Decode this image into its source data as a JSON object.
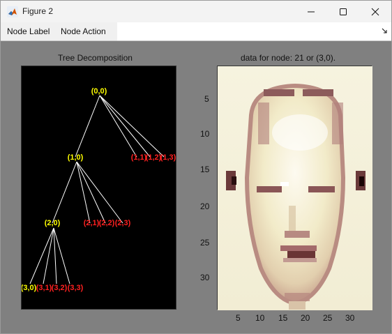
{
  "window": {
    "title": "Figure 2",
    "minimize_icon": "minimize-icon",
    "maximize_icon": "maximize-icon",
    "close_icon": "close-icon"
  },
  "menu": {
    "items": [
      "Node Label",
      "Node Action"
    ]
  },
  "colors": {
    "label_yellow": "#ffff00",
    "label_red": "#ff2020",
    "tree_lines": "#ffffff"
  },
  "tree": {
    "title": "Tree Decomposition",
    "nodes": {
      "n00": "(0,0)",
      "n10": "(1,0)",
      "n11": "(1,1)",
      "n12": "(1,2)",
      "n13": "(1,3)",
      "n20": "(2,0)",
      "n21": "(2,1)",
      "n22": "(2,2)",
      "n23": "(2,3)",
      "n30": "(3,0)",
      "n31": "(3,1)",
      "n32": "(3,2)",
      "n33": "(3,3)"
    }
  },
  "image_plot": {
    "title": "data for node: 21 or (3,0).",
    "x_ticks": [
      "5",
      "10",
      "15",
      "20",
      "25",
      "30"
    ],
    "y_ticks": [
      "5",
      "10",
      "15",
      "20",
      "25",
      "30"
    ]
  }
}
